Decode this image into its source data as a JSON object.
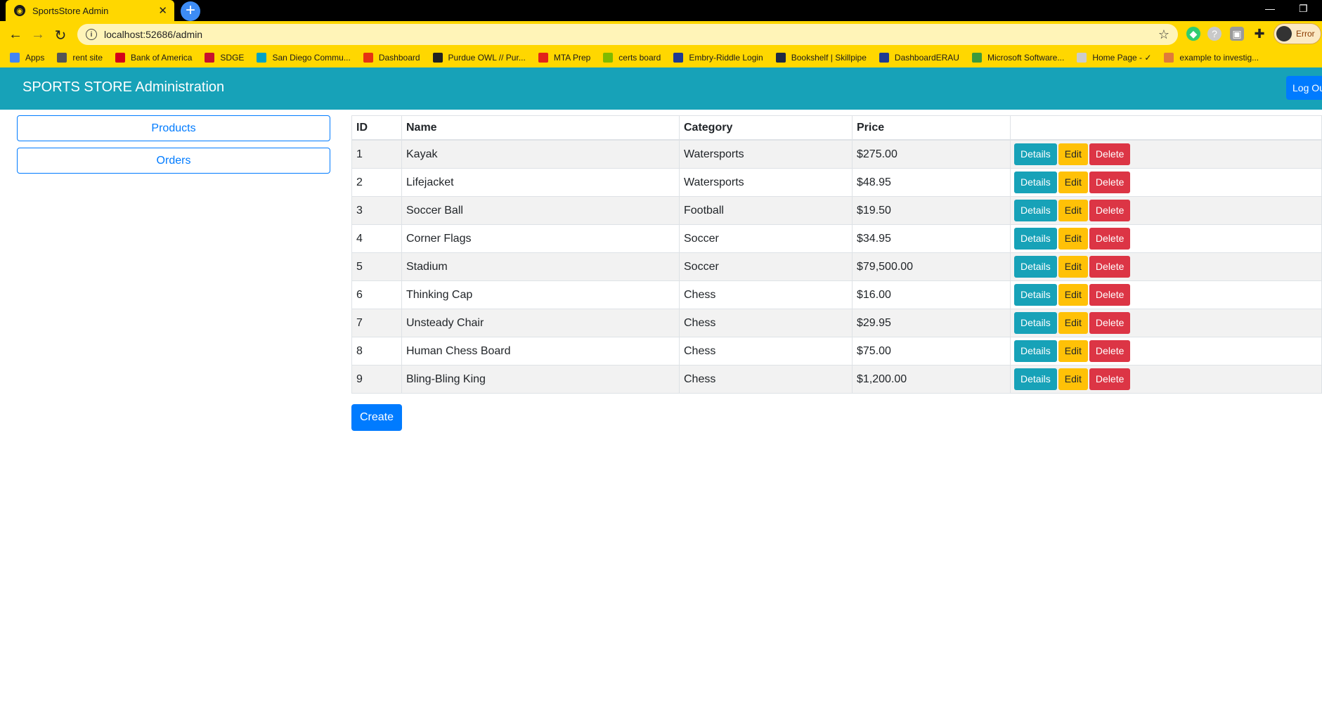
{
  "browser": {
    "tab_title": "SportsStore Admin",
    "url": "localhost:52686/admin",
    "profile_label": "Error",
    "bookmarks": [
      {
        "label": "Apps",
        "color": "#4285f4"
      },
      {
        "label": "rent site",
        "color": "#555555"
      },
      {
        "label": "Bank of America",
        "color": "#d4001a"
      },
      {
        "label": "SDGE",
        "color": "#c8102e"
      },
      {
        "label": "San Diego Commu...",
        "color": "#00a3c4"
      },
      {
        "label": "Dashboard",
        "color": "#e63312"
      },
      {
        "label": "Purdue OWL // Pur...",
        "color": "#222222"
      },
      {
        "label": "MTA Prep",
        "color": "#e2231a"
      },
      {
        "label": "certs board",
        "color": "#7fba00"
      },
      {
        "label": "Embry-Riddle Login",
        "color": "#1f3a93"
      },
      {
        "label": "Bookshelf | Skillpipe",
        "color": "#1f2a44"
      },
      {
        "label": "DashboardERAU",
        "color": "#1f3a93"
      },
      {
        "label": "Microsoft Software...",
        "color": "#3c9a3c"
      },
      {
        "label": "Home Page - ✓",
        "color": "#cccccc"
      },
      {
        "label": "example to investig...",
        "color": "#e07b39"
      }
    ]
  },
  "navbar": {
    "brand": "SPORTS STORE Administration",
    "logout_label": "Log Ou"
  },
  "sidebar": {
    "products_label": "Products",
    "orders_label": "Orders"
  },
  "table": {
    "headers": [
      "ID",
      "Name",
      "Category",
      "Price",
      ""
    ],
    "rows": [
      {
        "id": "1",
        "name": "Kayak",
        "category": "Watersports",
        "price": "$275.00"
      },
      {
        "id": "2",
        "name": "Lifejacket",
        "category": "Watersports",
        "price": "$48.95"
      },
      {
        "id": "3",
        "name": "Soccer Ball",
        "category": "Football",
        "price": "$19.50"
      },
      {
        "id": "4",
        "name": "Corner Flags",
        "category": "Soccer",
        "price": "$34.95"
      },
      {
        "id": "5",
        "name": "Stadium",
        "category": "Soccer",
        "price": "$79,500.00"
      },
      {
        "id": "6",
        "name": "Thinking Cap",
        "category": "Chess",
        "price": "$16.00"
      },
      {
        "id": "7",
        "name": "Unsteady Chair",
        "category": "Chess",
        "price": "$29.95"
      },
      {
        "id": "8",
        "name": "Human Chess Board",
        "category": "Chess",
        "price": "$75.00"
      },
      {
        "id": "9",
        "name": "Bling-Bling King",
        "category": "Chess",
        "price": "$1,200.00"
      }
    ],
    "details_label": "Details",
    "edit_label": "Edit",
    "delete_label": "Delete"
  },
  "create_label": "Create"
}
